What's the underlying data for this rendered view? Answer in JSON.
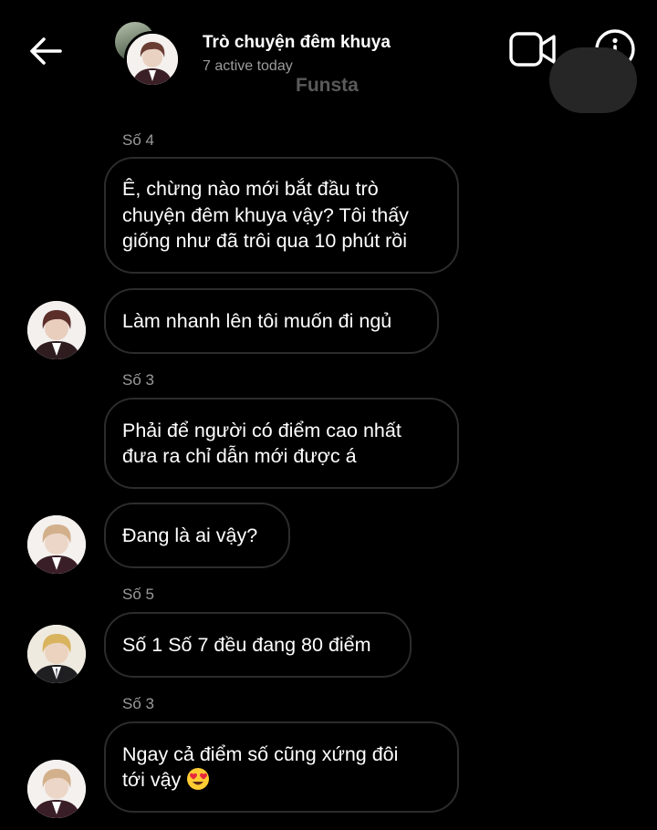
{
  "header": {
    "title": "Trò chuyện đêm khuya",
    "subtitle": "7 active today",
    "watermark": "Funsta"
  },
  "icons": {
    "back": "arrow-left-icon",
    "video": "video-camera-icon",
    "info": "info-icon"
  },
  "messages": [
    {
      "sender": "Số 4",
      "lines": [
        "Ê, chừng nào mới bắt đầu trò",
        "chuyện đêm khuya vậy? Tôi thấy",
        "giống như đã trôi qua 10 phút rồi"
      ]
    },
    {
      "lines": [
        "Làm nhanh lên tôi muốn đi ngủ"
      ]
    },
    {
      "sender": "Số 3",
      "lines": [
        "Phải để người có điểm cao nhất",
        "đưa ra chỉ dẫn mới được á"
      ]
    },
    {
      "lines": [
        "Đang là ai vậy?"
      ]
    },
    {
      "sender": "Số 5",
      "lines": [
        "Số 1 Số 7 đều đang 80 điểm"
      ]
    },
    {
      "sender": "Số 3",
      "lines": [
        "Ngay cả điểm số cũng xứng đôi",
        "tới vậy"
      ],
      "emoji": "heart-eyes-emoji"
    }
  ]
}
